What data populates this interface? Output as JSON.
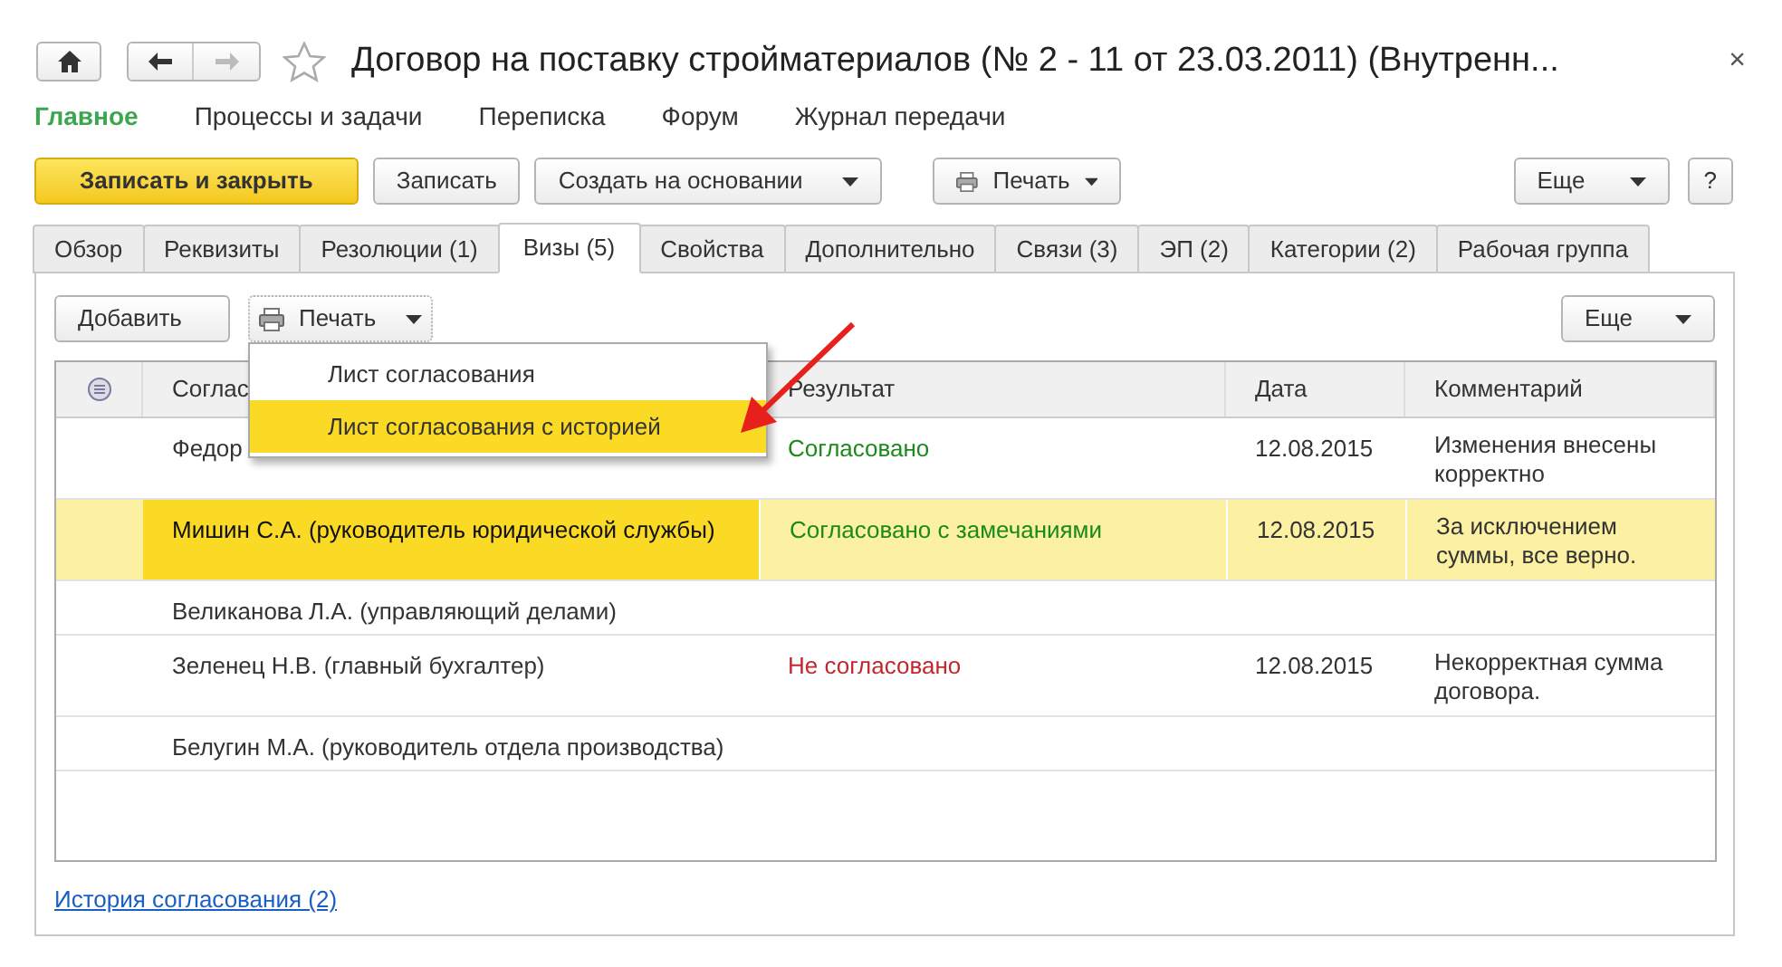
{
  "window": {
    "title": "Договор на поставку стройматериалов (№ 2 - 11 от 23.03.2011) (Внутренн...",
    "favorite": false,
    "close": "×"
  },
  "nav": [
    {
      "label": "Главное",
      "selected": true
    },
    {
      "label": "Процессы и задачи",
      "selected": false
    },
    {
      "label": "Переписка",
      "selected": false
    },
    {
      "label": "Форум",
      "selected": false
    },
    {
      "label": "Журнал передачи",
      "selected": false
    }
  ],
  "toolbar": [
    {
      "label": "Записать и закрыть",
      "kind": "primary"
    },
    {
      "label": "Записать",
      "kind": "plain"
    },
    {
      "label": "Создать на основании",
      "kind": "dropdown"
    },
    {
      "label": "Печать",
      "kind": "print"
    }
  ],
  "toolbar_right": [
    {
      "label": "Еще",
      "kind": "dropdown"
    },
    {
      "label": "?",
      "kind": "plain"
    }
  ],
  "tabs": [
    {
      "label": "Обзор",
      "selected": false
    },
    {
      "label": "Реквизиты",
      "selected": false
    },
    {
      "label": "Резолюции (1)",
      "selected": false
    },
    {
      "label": "Визы (5)",
      "selected": true
    },
    {
      "label": "Свойства",
      "selected": false
    },
    {
      "label": "Дополнительно",
      "selected": false
    },
    {
      "label": "Связи (3)",
      "selected": false
    },
    {
      "label": "ЭП (2)",
      "selected": false
    },
    {
      "label": "Категории (2)",
      "selected": false
    },
    {
      "label": "Рабочая группа",
      "selected": false
    }
  ],
  "panel_toolbar": [
    {
      "label": "Добавить",
      "kind": "plain"
    },
    {
      "label": "Печать",
      "kind": "print"
    }
  ],
  "panel_more": {
    "label": "Еще",
    "kind": "dropdown"
  },
  "print_menu": [
    {
      "label": "Лист согласования",
      "selected": false
    },
    {
      "label": "Лист согласования с историей",
      "selected": true
    }
  ],
  "table": {
    "columns": [
      "Соглас",
      "Результат",
      "Дата",
      "Комментарий"
    ],
    "rows": [
      {
        "name": "Федор",
        "result": "Согласовано",
        "color": "#1b8a1b",
        "date": "12.08.2015",
        "comment": "Изменения внесены корректно",
        "selected": false
      },
      {
        "name": "Мишин С.А. (руководитель юридической службы)",
        "result": "Согласовано с замечаниями",
        "color": "#1b8a1b",
        "date": "12.08.2015",
        "comment": "За исключением суммы, все верно.",
        "selected": true
      },
      {
        "name": "Великанова Л.А. (управляющий делами)",
        "selected": false
      },
      {
        "name": "Зеленец Н.В. (главный бухгалтер)",
        "result": "Не согласовано",
        "color": "#c0282d",
        "date": "12.08.2015",
        "comment": "Некорректная сумма договора.",
        "selected": false
      },
      {
        "name": "Белугин М.А. (руководитель отдела производства)",
        "selected": false
      }
    ]
  },
  "history_link": "История согласования (2)"
}
